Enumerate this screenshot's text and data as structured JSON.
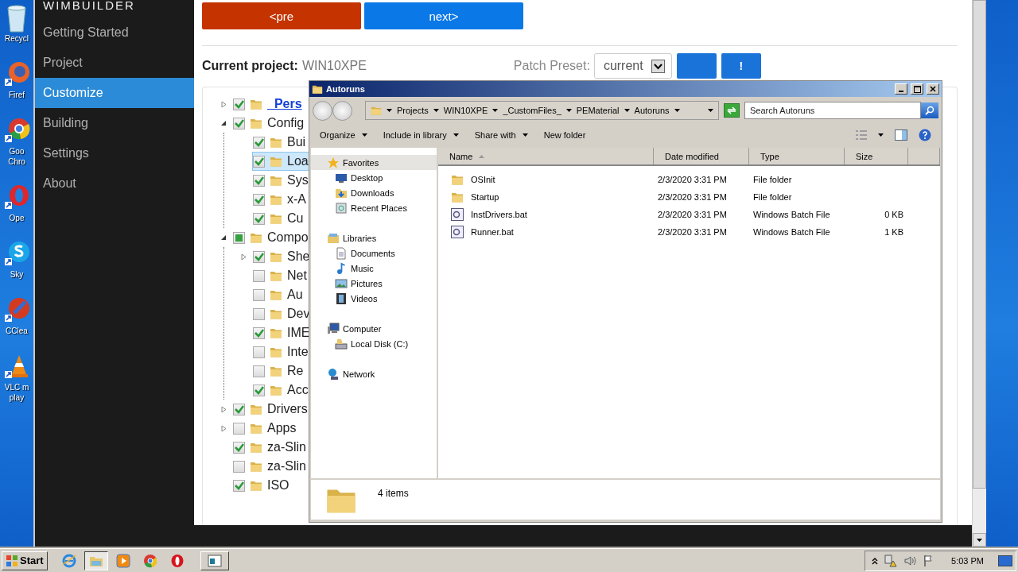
{
  "desktop_icons": [
    {
      "kind": "recycle",
      "lines": [
        "Recycl"
      ]
    },
    {
      "kind": "firefox",
      "lines": [
        "Firef"
      ]
    },
    {
      "kind": "chrome",
      "lines": [
        "Goo",
        "Chro"
      ]
    },
    {
      "kind": "opera",
      "lines": [
        "Ope"
      ]
    },
    {
      "kind": "skype",
      "lines": [
        "Sky"
      ]
    },
    {
      "kind": "ccleaner",
      "lines": [
        "CClea"
      ]
    },
    {
      "kind": "vlc",
      "lines": [
        "VLC m",
        "play"
      ]
    }
  ],
  "wimbuilder": {
    "title": "WIMBUILDER",
    "nav": [
      {
        "label": "Getting Started",
        "selected": false
      },
      {
        "label": "Project",
        "selected": false
      },
      {
        "label": "Customize",
        "selected": true
      },
      {
        "label": "Building",
        "selected": false
      },
      {
        "label": "Settings",
        "selected": false
      },
      {
        "label": "About",
        "selected": false
      }
    ],
    "prev_button": "<pre",
    "next_button": "next>",
    "project_label": "Current project:",
    "project_name": "WIN10XPE",
    "preset_label": "Patch Preset:",
    "preset_value": "current",
    "apply_button": "!",
    "tree": [
      {
        "label": "_Pers",
        "checked": true,
        "expanded": false,
        "selected": false,
        "emphasis": true
      },
      {
        "label": "Config",
        "checked": true,
        "expanded": true,
        "selected": false,
        "children": [
          {
            "label": "Bui",
            "checked": true,
            "selected": false
          },
          {
            "label": "Loa",
            "checked": true,
            "selected": true
          },
          {
            "label": "Sys",
            "checked": true,
            "selected": false
          },
          {
            "label": "x-A",
            "checked": true,
            "selected": false
          },
          {
            "label": "Cu",
            "checked": true,
            "selected": false
          }
        ]
      },
      {
        "label": "Compo",
        "checked": false,
        "partial": true,
        "expanded": true,
        "selected": false,
        "children": [
          {
            "label": "She",
            "checked": true,
            "expanded": false,
            "selected": false
          },
          {
            "label": "Net",
            "checked": false,
            "selected": false
          },
          {
            "label": "Au",
            "checked": false,
            "selected": false
          },
          {
            "label": "Dev",
            "checked": false,
            "selected": false
          },
          {
            "label": "IME",
            "checked": true,
            "selected": false
          },
          {
            "label": "Inte",
            "checked": false,
            "selected": false
          },
          {
            "label": "Re",
            "checked": false,
            "selected": false
          },
          {
            "label": "Acc",
            "checked": true,
            "selected": false
          }
        ]
      },
      {
        "label": "Drivers",
        "checked": true,
        "expanded": false,
        "selected": false
      },
      {
        "label": "Apps",
        "checked": false,
        "expanded": false,
        "selected": false
      },
      {
        "label": "za-Slin",
        "checked": true,
        "selected": false
      },
      {
        "label": "za-Slin",
        "checked": false,
        "selected": false
      },
      {
        "label": "ISO",
        "checked": true,
        "selected": false
      }
    ]
  },
  "explorer": {
    "title": "Autoruns",
    "breadcrumbs": [
      "Projects",
      "WIN10XPE",
      "_CustomFiles_",
      "PEMaterial",
      "Autoruns"
    ],
    "search_placeholder": "Search Autoruns",
    "toolbar": [
      {
        "label": "Organize",
        "menu": true
      },
      {
        "label": "Include in library",
        "menu": true
      },
      {
        "label": "Share with",
        "menu": true
      },
      {
        "label": "New folder",
        "menu": false
      }
    ],
    "nav": [
      {
        "label": "Favorites",
        "kind": "star",
        "selected": true,
        "children": [
          {
            "label": "Desktop",
            "kind": "desktop"
          },
          {
            "label": "Downloads",
            "kind": "downloads"
          },
          {
            "label": "Recent Places",
            "kind": "recent"
          }
        ]
      },
      {
        "label": "Libraries",
        "kind": "library",
        "selected": false,
        "children": [
          {
            "label": "Documents",
            "kind": "documents"
          },
          {
            "label": "Music",
            "kind": "music"
          },
          {
            "label": "Pictures",
            "kind": "pictures"
          },
          {
            "label": "Videos",
            "kind": "videos"
          }
        ]
      },
      {
        "label": "Computer",
        "kind": "computer",
        "selected": false,
        "children": [
          {
            "label": "Local Disk (C:)",
            "kind": "disk"
          }
        ]
      },
      {
        "label": "Network",
        "kind": "network",
        "selected": false
      }
    ],
    "columns": [
      {
        "label": "Name",
        "sorted": true
      },
      {
        "label": "Date modified",
        "sorted": false
      },
      {
        "label": "Type",
        "sorted": false
      },
      {
        "label": "Size",
        "sorted": false
      }
    ],
    "files": [
      {
        "name": "OSInit",
        "date": "2/3/2020 3:31 PM",
        "type": "File folder",
        "kind": "folder"
      },
      {
        "name": "Startup",
        "date": "2/3/2020 3:31 PM",
        "type": "File folder",
        "kind": "folder"
      },
      {
        "name": "InstDrivers.bat",
        "date": "2/3/2020 3:31 PM",
        "type": "Windows Batch File",
        "size": "0 KB",
        "kind": "batch"
      },
      {
        "name": "Runner.bat",
        "date": "2/3/2020 3:31 PM",
        "type": "Windows Batch File",
        "size": "1 KB",
        "kind": "batch"
      }
    ],
    "status": "4 items"
  },
  "taskbar": {
    "start": "Start",
    "apps": [
      {
        "kind": "ie",
        "selected": false
      },
      {
        "kind": "explorer",
        "selected": true
      },
      {
        "kind": "media",
        "selected": false
      },
      {
        "kind": "chrome",
        "selected": false
      },
      {
        "kind": "opera",
        "selected": false
      },
      {
        "kind": "task",
        "selected": false
      }
    ],
    "clock": "5:03 PM"
  }
}
